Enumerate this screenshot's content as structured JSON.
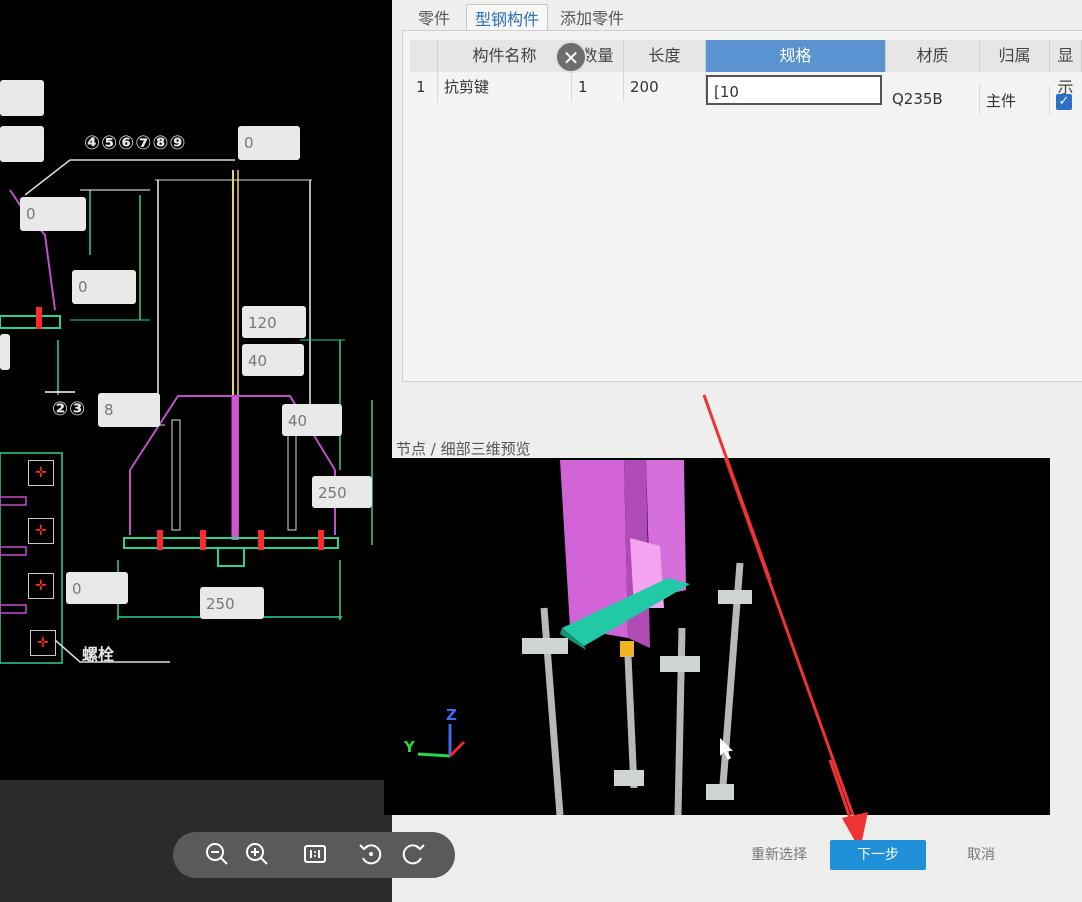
{
  "tabs": [
    {
      "label": "零件",
      "active": false
    },
    {
      "label": "型钢构件",
      "active": true
    },
    {
      "label": "添加零件",
      "active": false
    }
  ],
  "table": {
    "columns": [
      "构件名称",
      "数量",
      "长度",
      "规格",
      "材质",
      "归属",
      "显示"
    ],
    "rows": [
      {
        "index": "1",
        "name": "抗剪键",
        "qty": "1",
        "length": "200",
        "spec": "[10",
        "material": "Q235B",
        "belong": "主件",
        "show": true
      }
    ]
  },
  "close_glyph": "✕",
  "preview_title": "节点 / 细部三维预览",
  "axis_labels": {
    "y": "Y",
    "z": "Z"
  },
  "buttons": {
    "reselect": "重新选择",
    "next": "下一步",
    "cancel": "取消"
  },
  "cad": {
    "dims": [
      "0",
      "0",
      "0",
      "120",
      "40",
      "8",
      "40",
      "250",
      "0",
      "250"
    ],
    "circled_top": "④⑤⑥⑦⑧⑨",
    "circled_mid": "②③",
    "bolt_label": "螺栓"
  },
  "toolbar_icons": [
    "zoom-out-icon",
    "zoom-in-icon",
    "actual-size-icon",
    "rotate-left-icon",
    "rotate-right-icon"
  ],
  "colors": {
    "accent": "#1f8fd8",
    "highlight_header": "#5a93d0",
    "annotation_arrow": "#ee3333"
  }
}
